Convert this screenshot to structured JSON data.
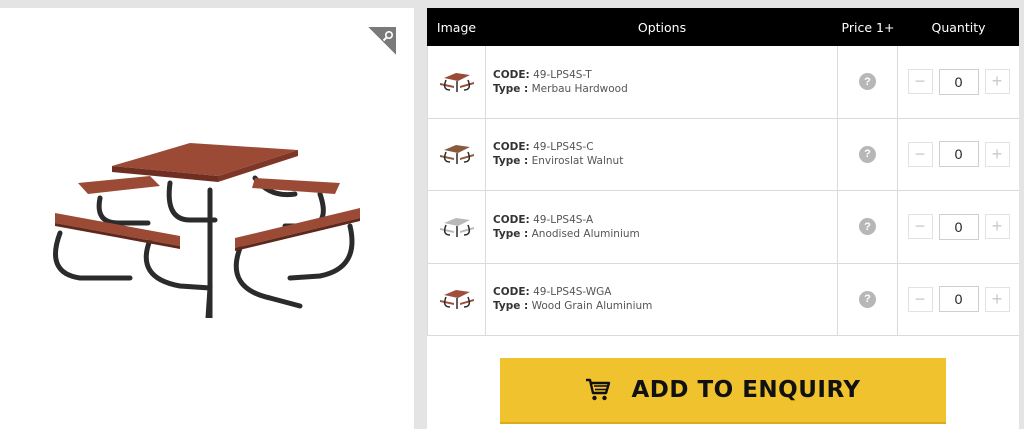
{
  "table": {
    "headers": {
      "image": "Image",
      "options": "Options",
      "price": "Price 1+",
      "quantity": "Quantity"
    },
    "rows": [
      {
        "code_label": "CODE:",
        "code": "49-LPS4S-T",
        "type_label": "Type :",
        "type": "Merbau Hardwood",
        "quantity": "0",
        "help": "?",
        "minus": "−",
        "plus": "+"
      },
      {
        "code_label": "CODE:",
        "code": "49-LPS4S-C",
        "type_label": "Type :",
        "type": "Enviroslat Walnut",
        "quantity": "0",
        "help": "?",
        "minus": "−",
        "plus": "+"
      },
      {
        "code_label": "CODE:",
        "code": "49-LPS4S-A",
        "type_label": "Type :",
        "type": "Anodised Aluminium",
        "quantity": "0",
        "help": "?",
        "minus": "−",
        "plus": "+"
      },
      {
        "code_label": "CODE:",
        "code": "49-LPS4S-WGA",
        "type_label": "Type :",
        "type": "Wood Grain Aluminium",
        "quantity": "0",
        "help": "?",
        "minus": "−",
        "plus": "+"
      }
    ]
  },
  "enquiry": {
    "label": "ADD TO ENQUIRY"
  },
  "colors": {
    "accent": "#f0c22e",
    "header_bg": "#000000",
    "wood": "#9b4a35",
    "frame": "#2b2b2b"
  },
  "icons": {
    "zoom": "magnifier-icon",
    "cart": "cart-icon",
    "help": "question-icon"
  }
}
